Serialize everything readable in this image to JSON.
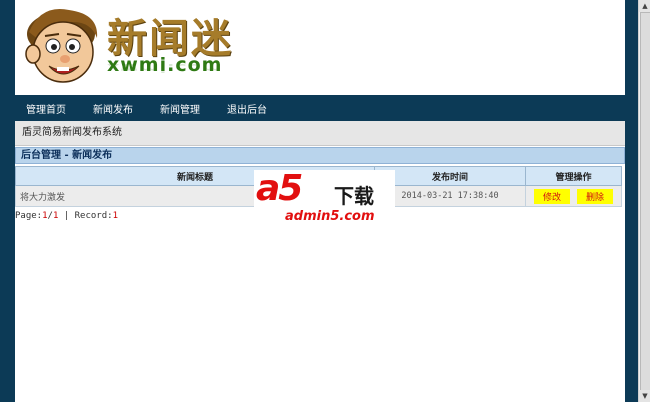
{
  "logo": {
    "cn": "新闻迷",
    "en": "xwmi.com"
  },
  "nav": [
    {
      "label": "管理首页"
    },
    {
      "label": "新闻发布"
    },
    {
      "label": "新闻管理"
    },
    {
      "label": "退出后台"
    }
  ],
  "system_title": "盾灵简易新闻发布系统",
  "breadcrumb": "后台管理 - 新闻发布",
  "table": {
    "headers": [
      "新闻标题",
      "发布时间",
      "管理操作"
    ],
    "rows": [
      {
        "title": "将大力激发",
        "time": "2014-03-21 17:38:40",
        "edit": "修改",
        "delete": "删除"
      }
    ]
  },
  "pager": {
    "page_label": "Page:",
    "current": "1",
    "sep": "/",
    "total": "1",
    "divider": " | ",
    "record_label": "Record:",
    "record": "1"
  },
  "watermark": {
    "brand": "a5",
    "suffix": "下载",
    "url": "admin5.com"
  },
  "colors": {
    "frame": "#0c3a56",
    "header_row": "#d3e6f6",
    "button": "#ffff00",
    "button_text": "#d01010"
  }
}
